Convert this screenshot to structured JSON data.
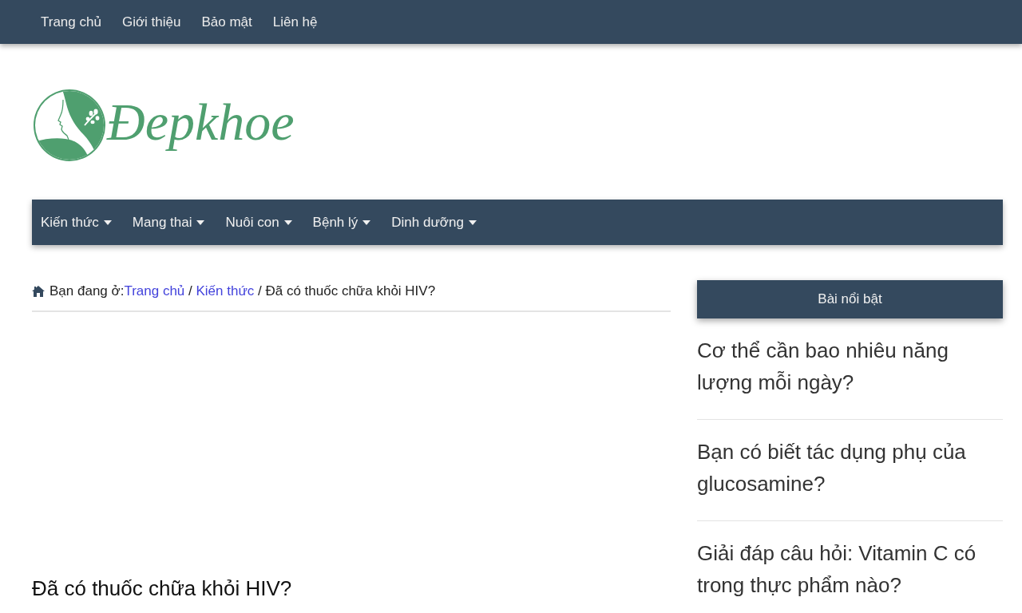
{
  "top_nav": {
    "items": [
      "Trang chủ",
      "Giới thiệu",
      "Bảo mật",
      "Liên hệ"
    ]
  },
  "logo": {
    "wordmark": "Đepkhoe"
  },
  "main_nav": {
    "items": [
      {
        "label": "Kiến thức",
        "has_dropdown": true
      },
      {
        "label": "Mang thai",
        "has_dropdown": true
      },
      {
        "label": "Nuôi con",
        "has_dropdown": true
      },
      {
        "label": "Bệnh lý",
        "has_dropdown": true
      },
      {
        "label": "Dinh dưỡng",
        "has_dropdown": true
      }
    ]
  },
  "breadcrumb": {
    "parts": [
      {
        "kind": "text",
        "text": "Bạn đang ở:"
      },
      {
        "kind": "link",
        "text": "Trang chủ"
      },
      {
        "kind": "text",
        "text": " / "
      },
      {
        "kind": "link",
        "text": "Kiến thức"
      },
      {
        "kind": "text",
        "text": " / Đã có thuốc chữa khỏi HIV?"
      }
    ]
  },
  "article": {
    "title": "Đã có thuốc chữa khỏi HIV?"
  },
  "sidebar": {
    "title": "Bài nổi bật",
    "posts": [
      "Cơ thể cần bao nhiêu năng lượng mỗi ngày?",
      "Bạn có biết tác dụng phụ của glucosamine?",
      "Giải đáp câu hỏi: Vitamin C có trong thực phẩm nào?"
    ]
  }
}
